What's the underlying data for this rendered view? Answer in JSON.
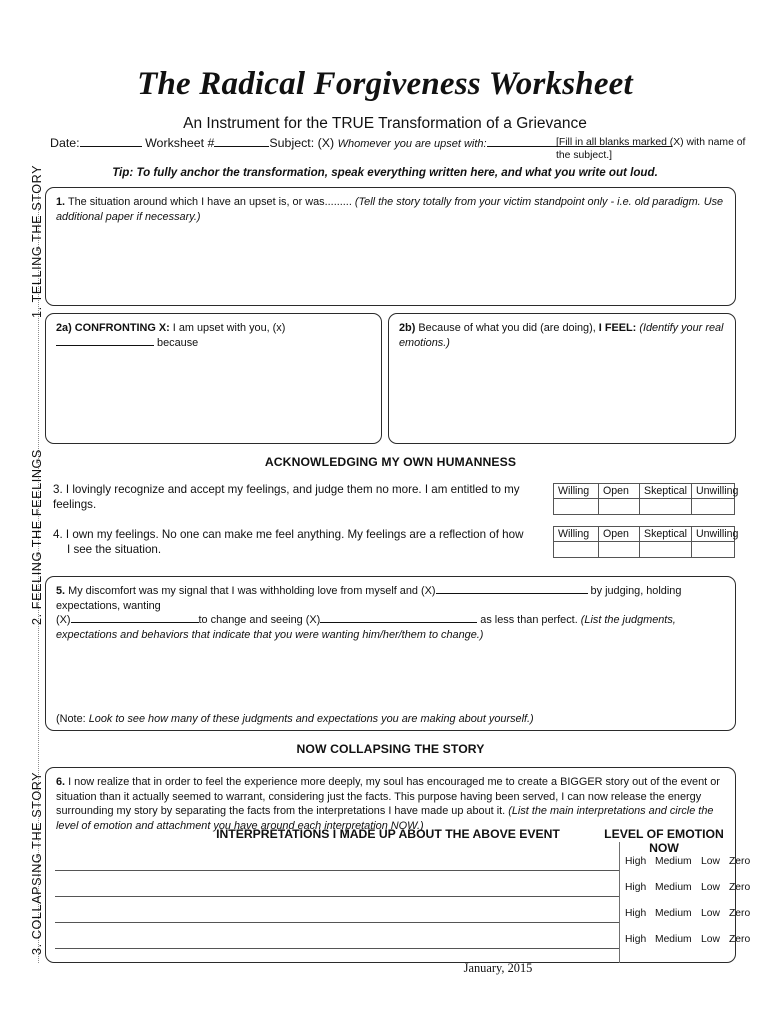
{
  "header": {
    "title": "The Radical Forgiveness Worksheet",
    "subtitle": "An Instrument for the TRUE Transformation of a Grievance",
    "meta": {
      "date_label": "Date:",
      "worksheet_label": "Worksheet #",
      "subject_label": "Subject: (X)",
      "subject_italic": "Whomever",
      "subject_rest": "you are upset with:",
      "fill_note": "[Fill in all blanks marked (X) with name of the subject.]"
    },
    "tip": "Tip: To fully anchor the transformation, speak everything written here, and what you write out loud."
  },
  "sections": {
    "rail_labels": [
      "1. TELLING THE STORY",
      "2. FEELING THE FEELINGS",
      "3. COLLAPSING THE STORY"
    ]
  },
  "item1": {
    "number": "1.",
    "text": "The situation around which I have an upset is, or was.........",
    "italic": "(Tell the story totally from your victim standpoint only - i.e. old paradigm.  Use additional paper if necessary.)"
  },
  "item2a": {
    "label": "2a) CONFRONTING X:",
    "text_before": "I am upset with you, (x)",
    "text_after": "because"
  },
  "item2b": {
    "label": "2b)",
    "text": "Because of what you did (are doing),",
    "bold": "I FEEL:",
    "italic": "(Identify your real emotions.)"
  },
  "humanness": {
    "heading": "ACKNOWLEDGING MY OWN HUMANNESS",
    "item3": "3.  I lovingly recognize and accept my feelings, and judge them no more. I am entitled to my feelings.",
    "item4_line1": "4.  I own my feelings. No one can make me feel anything. My feelings are a reflection of how",
    "item4_line2": "I see the situation.",
    "scale_headers": [
      "Willing",
      "Open",
      "Skeptical",
      "Unwilling"
    ]
  },
  "item5": {
    "number": "5.",
    "seg1": "My discomfort was my signal that I was withholding love from myself and (X)",
    "seg2": "by judging, holding expectations, wanting",
    "seg3": "(X)",
    "seg4": "to change and seeing (X)",
    "seg5": "as less than perfect.",
    "italic1": "(List the judgments, expectations and behaviors that indicate that you were wanting him/her/them to change.)",
    "note_prefix": "(Note:",
    "note_italic": "Look to see how many of these judgments and expectations you are making about yourself.)"
  },
  "collapsing": {
    "heading": "NOW COLLAPSING THE STORY",
    "item6_number": "6.",
    "item6_text": "I now realize that in order to feel the experience more deeply, my soul has encouraged me to create a BIGGER story out of the event or situation than it actually seemed to warrant, considering just the facts.  This purpose having been served, I can now release the energy surrounding my story by separating the facts from the interpretations I have made up about it.",
    "item6_italic": "(List the main interpretations and circle the level of emotion and attachment you have around each interpretation NOW.)",
    "interpretations_heading": "INTERPRETATIONS I MADE UP ABOUT THE ABOVE EVENT",
    "emotion_heading": "LEVEL OF EMOTION NOW",
    "emotion_levels": [
      "High",
      "Medium",
      "Low",
      "Zero"
    ],
    "emotion_rows": 4
  },
  "footer": {
    "date": "January, 2015"
  }
}
